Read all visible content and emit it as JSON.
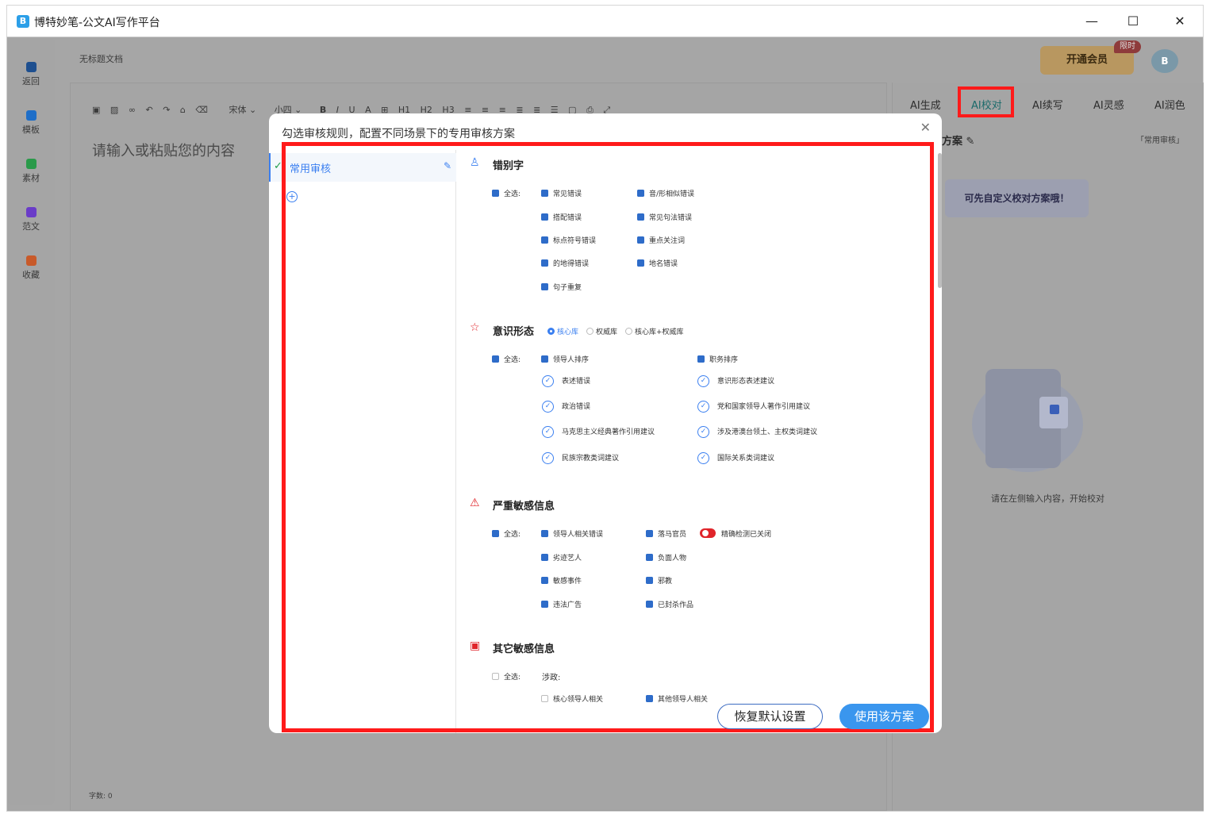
{
  "window": {
    "title": "博特妙笔-公文AI写作平台",
    "logo": "B",
    "controls": [
      "—",
      "☐",
      "✕"
    ]
  },
  "sidebar": {
    "items": [
      {
        "label": "返回",
        "icon": "home-icon",
        "color": "#1e4f8f"
      },
      {
        "label": "模板",
        "icon": "template-icon",
        "color": "#1e6ec8"
      },
      {
        "label": "素材",
        "icon": "material-icon",
        "color": "#2a9a4a"
      },
      {
        "label": "范文",
        "icon": "sample-icon",
        "color": "#6a3cc8"
      },
      {
        "label": "收藏",
        "icon": "favorite-icon",
        "color": "#c85a2a"
      }
    ]
  },
  "doc": {
    "title": "无标题文档",
    "placeholder": "请输入或粘贴您的内容",
    "word_count": "字数: 0"
  },
  "toolbar": {
    "font": "宋体 ⌄",
    "size": "小四 ⌄",
    "h1": "H1",
    "h2": "H2",
    "h3": "H3",
    "bold": "B",
    "italic": "I",
    "underline": "U",
    "color": "A"
  },
  "header": {
    "vip_label": "开通会员",
    "vip_badge": "限时",
    "avatar": "B"
  },
  "right_panel": {
    "tabs": [
      "AI生成",
      "AI校对",
      "AI续写",
      "AI灵感",
      "AI润色"
    ],
    "active_tab": "AI校对",
    "scheme_label": "方案",
    "scheme_current": "「常用审核」",
    "custom_tip": "可先自定义校对方案哦！",
    "empty_text": "请在左侧输入内容，开始校对"
  },
  "modal": {
    "title": "勾选审核规则，配置不同场景下的专用审核方案",
    "rule_name": "常用审核",
    "restore_label": "恢复默认设置",
    "use_label": "使用该方案",
    "sections": {
      "typo": {
        "title": "错别字",
        "select_all": "全选:",
        "items": [
          "常见错误",
          "音/形相似错误",
          "搭配错误",
          "常见句法错误",
          "标点符号错误",
          "重点关注词",
          "的地得错误",
          "地名错误",
          "句子重复"
        ]
      },
      "ideology": {
        "title": "意识形态",
        "radios": [
          "核心库",
          "权威库",
          "核心库+权威库"
        ],
        "select_all": "全选:",
        "checks": [
          "领导人排序",
          "职务排序"
        ],
        "items": [
          "表述错误",
          "意识形态表述建议",
          "政治错误",
          "党和国家领导人著作引用建议",
          "马克思主义经典著作引用建议",
          "涉及港澳台领土、主权类词建议",
          "民族宗教类词建议",
          "国际关系类词建议"
        ]
      },
      "sensitive": {
        "title": "严重敏感信息",
        "select_all": "全选:",
        "items": [
          "领导人相关错误",
          "落马官员",
          "劣迹艺人",
          "负面人物",
          "敏感事件",
          "邪教",
          "违法广告",
          "已封杀作品"
        ],
        "toggle_label": "精确检测已关闭"
      },
      "other": {
        "title": "其它敏感信息",
        "select_all": "全选:",
        "group": "涉政:",
        "items": [
          "核心领导人相关",
          "其他领导人相关"
        ]
      }
    }
  }
}
